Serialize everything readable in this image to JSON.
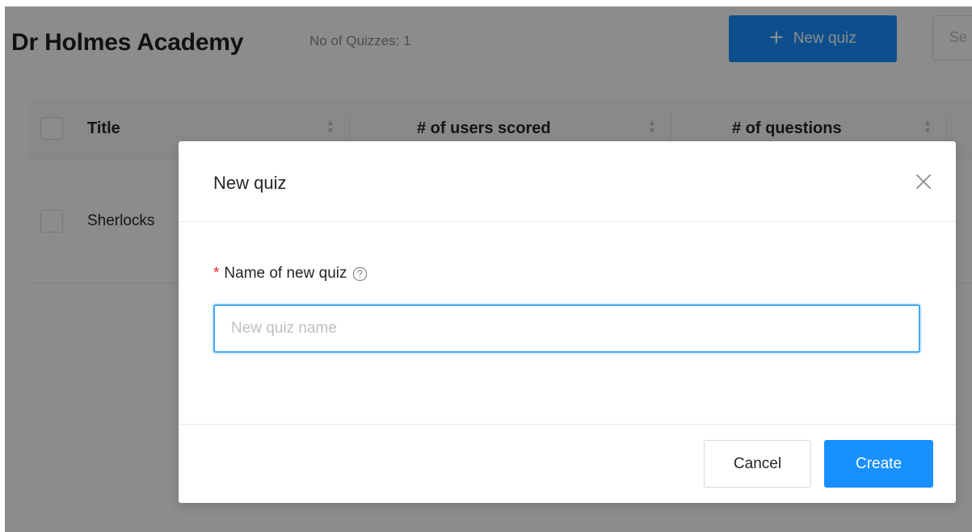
{
  "header": {
    "app_title": "Dr Holmes Academy",
    "quiz_count": "No of Quizzes: 1",
    "new_quiz_label": "New quiz",
    "search_placeholder": "Se"
  },
  "table": {
    "columns": [
      "Title",
      "# of users scored",
      "# of questions"
    ],
    "rows": [
      {
        "title": "Sherlocks"
      }
    ]
  },
  "modal": {
    "title": "New quiz",
    "field_label": "Name of new quiz",
    "required_mark": "*",
    "input_value": "",
    "input_placeholder": "New quiz name",
    "cancel_label": "Cancel",
    "create_label": "Create"
  },
  "colors": {
    "primary": "#1890ff",
    "input_focus": "#40a9ff",
    "required": "#f5222d",
    "mask": "rgba(0,0,0,0.45)"
  },
  "icons": {
    "new_quiz": "plus-icon",
    "sort": "sort-icon",
    "close": "close-icon",
    "help": "question-circle-icon"
  }
}
